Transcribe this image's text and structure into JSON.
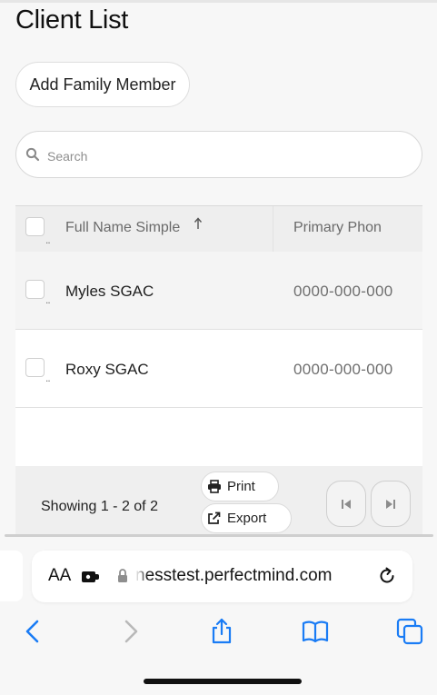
{
  "page": {
    "title": "Client List"
  },
  "actions": {
    "add_family_member": "Add Family Member"
  },
  "search": {
    "placeholder": "Search"
  },
  "grid": {
    "header": {
      "full_name": "Full Name Simple",
      "primary_phone": "Primary Phon",
      "sort_direction": "ascending"
    },
    "rows": [
      {
        "name": "Myles SGAC",
        "phone": "0000-000-000"
      },
      {
        "name": "Roxy SGAC",
        "phone": "0000-000-000"
      }
    ],
    "footer": {
      "status": "Showing 1 - 2 of 2",
      "print_label": "Print",
      "export_label": "Export"
    }
  },
  "browser": {
    "text_size_label": "AA",
    "url": "nesstest.perfectmind.com",
    "toolbar": [
      "back-icon",
      "forward-icon",
      "share-icon",
      "bookmarks-icon",
      "tabs-icon"
    ]
  },
  "colors": {
    "accent": "#1a7cf5",
    "disabled": "#b9b9b9"
  }
}
